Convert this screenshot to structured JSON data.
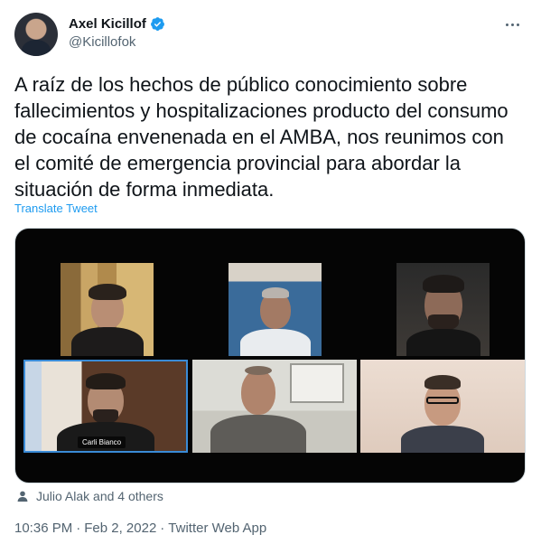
{
  "author": {
    "display_name": "Axel Kicillof",
    "handle": "@Kicillofok"
  },
  "tweet": {
    "text": "A raíz de los hechos de público conocimiento sobre fallecimientos y hospitalizaciones producto del consumo de cocaína envenenada en el AMBA, nos reunimos con el comité de emergencia provincial para abordar la situación de forma inmediata.",
    "translate_label": "Translate Tweet"
  },
  "media": {
    "participant_label": "Carli Bianco"
  },
  "reactions": {
    "liked_by": "Julio Alak and 4 others"
  },
  "meta": {
    "time": "10:36 PM",
    "separator1": "·",
    "date": "Feb 2, 2022",
    "separator2": "·",
    "source": "Twitter Web App"
  },
  "colors": {
    "link": "#1d9bf0",
    "secondary_text": "#536471",
    "primary_text": "#0f1419",
    "verified_badge": "#1d9bf0",
    "active_speaker_border": "#3a8bd6"
  },
  "icons": {
    "verified": "verified-badge-icon",
    "more": "more-options-icon",
    "liked_by": "person-icon"
  }
}
